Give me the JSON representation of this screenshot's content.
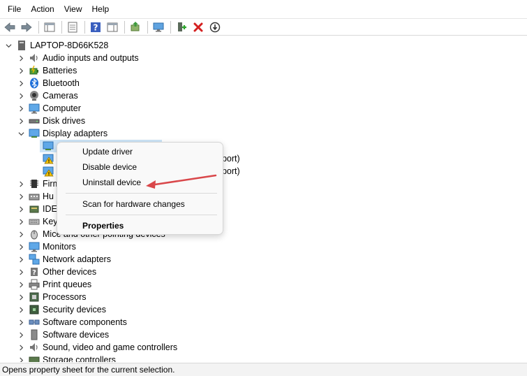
{
  "menu": [
    "File",
    "Action",
    "View",
    "Help"
  ],
  "toolbar_icons": [
    "back-arrow-icon",
    "forward-arrow-icon",
    "console-tree-icon",
    "properties-icon",
    "help-icon",
    "action-pane-icon",
    "update-driver-icon",
    "scan-hardware-icon",
    "enable-device-icon",
    "uninstall-x-icon",
    "disable-device-icon"
  ],
  "root": "LAPTOP-8D66K528",
  "categories": [
    "Audio inputs and outputs",
    "Batteries",
    "Bluetooth",
    "Cameras",
    "Computer",
    "Disk drives",
    "Display adapters"
  ],
  "display_children_partial": [
    "pport)",
    "pport)"
  ],
  "partial_categories": [
    "Firm",
    "Hu",
    "IDE",
    "Key",
    "Mice and other pointing devices"
  ],
  "categories_after": [
    "Monitors",
    "Network adapters",
    "Other devices",
    "Print queues",
    "Processors",
    "Security devices",
    "Software components",
    "Software devices",
    "Sound, video and game controllers",
    "Storage controllers"
  ],
  "context_menu": {
    "update": "Update driver",
    "disable": "Disable device",
    "uninstall": "Uninstall device",
    "scan": "Scan for hardware changes",
    "properties": "Properties"
  },
  "status_text": "Opens property sheet for the current selection.",
  "colors": {
    "accent_blue": "#1e6fd9",
    "warning_yellow": "#f2c200",
    "delete_red": "#d42020",
    "arrow_red": "#d9474a"
  }
}
